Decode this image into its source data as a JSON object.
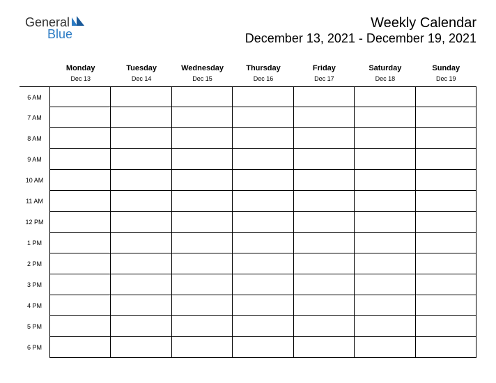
{
  "logo": {
    "general": "General",
    "blue": "Blue"
  },
  "title": {
    "main": "Weekly Calendar",
    "range": "December 13, 2021 - December 19, 2021"
  },
  "days": [
    {
      "name": "Monday",
      "date": "Dec 13"
    },
    {
      "name": "Tuesday",
      "date": "Dec 14"
    },
    {
      "name": "Wednesday",
      "date": "Dec 15"
    },
    {
      "name": "Thursday",
      "date": "Dec 16"
    },
    {
      "name": "Friday",
      "date": "Dec 17"
    },
    {
      "name": "Saturday",
      "date": "Dec 18"
    },
    {
      "name": "Sunday",
      "date": "Dec 19"
    }
  ],
  "hours": [
    "6 AM",
    "7 AM",
    "8 AM",
    "9 AM",
    "10 AM",
    "11 AM",
    "12 PM",
    "1 PM",
    "2 PM",
    "3 PM",
    "4 PM",
    "5 PM",
    "6 PM"
  ]
}
